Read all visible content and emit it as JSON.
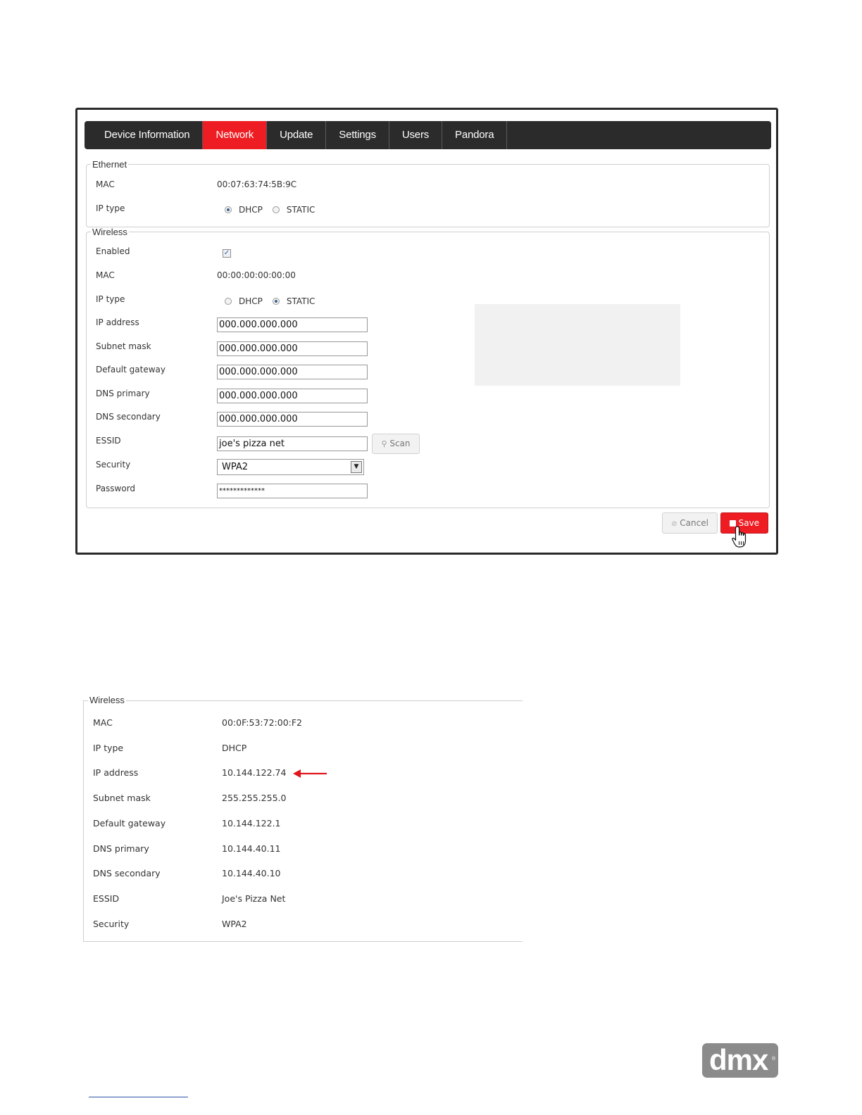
{
  "tabs": [
    {
      "label": "Device Information"
    },
    {
      "label": "Network",
      "active": true
    },
    {
      "label": "Update"
    },
    {
      "label": "Settings"
    },
    {
      "label": "Users"
    },
    {
      "label": "Pandora"
    }
  ],
  "ethernet": {
    "legend": "Ethernet",
    "mac_label": "MAC",
    "mac_value": "00:07:63:74:5B:9C",
    "ip_type_label": "IP type",
    "dhcp_label": "DHCP",
    "static_label": "STATIC",
    "ip_type_selected": "DHCP"
  },
  "wireless": {
    "legend": "Wireless",
    "enabled_label": "Enabled",
    "enabled": true,
    "mac_label": "MAC",
    "mac_value": "00:00:00:00:00:00",
    "ip_type_label": "IP type",
    "dhcp_label": "DHCP",
    "static_label": "STATIC",
    "ip_type_selected": "STATIC",
    "ip_address_label": "IP address",
    "ip_address_value": "000.000.000.000",
    "subnet_mask_label": "Subnet mask",
    "subnet_mask_value": "000.000.000.000",
    "default_gateway_label": "Default gateway",
    "default_gateway_value": "000.000.000.000",
    "dns_primary_label": "DNS primary",
    "dns_primary_value": "000.000.000.000",
    "dns_secondary_label": "DNS secondary",
    "dns_secondary_value": "000.000.000.000",
    "essid_label": "ESSID",
    "essid_value": "joe's pizza net",
    "scan_label": "Scan",
    "security_label": "Security",
    "security_value": "WPA2",
    "password_label": "Password",
    "password_value": "*************"
  },
  "buttons": {
    "cancel_label": "Cancel",
    "save_label": "Save"
  },
  "wireless_status": {
    "legend": "Wireless",
    "rows": [
      {
        "label": "MAC",
        "value": "00:0F:53:72:00:F2"
      },
      {
        "label": "IP type",
        "value": "DHCP"
      },
      {
        "label": "IP address",
        "value": "10.144.122.74"
      },
      {
        "label": "Subnet mask",
        "value": "255.255.255.0"
      },
      {
        "label": "Default gateway",
        "value": "10.144.122.1"
      },
      {
        "label": "DNS primary",
        "value": "10.144.40.11"
      },
      {
        "label": "DNS secondary",
        "value": "10.144.40.10"
      },
      {
        "label": "ESSID",
        "value": "Joe's Pizza Net"
      },
      {
        "label": "Security",
        "value": "WPA2"
      }
    ]
  },
  "logo": {
    "text": "dmx"
  },
  "colors": {
    "accent": "#ee1d23",
    "tabbar": "#2b2b2b",
    "arrow": "#e0161c"
  }
}
